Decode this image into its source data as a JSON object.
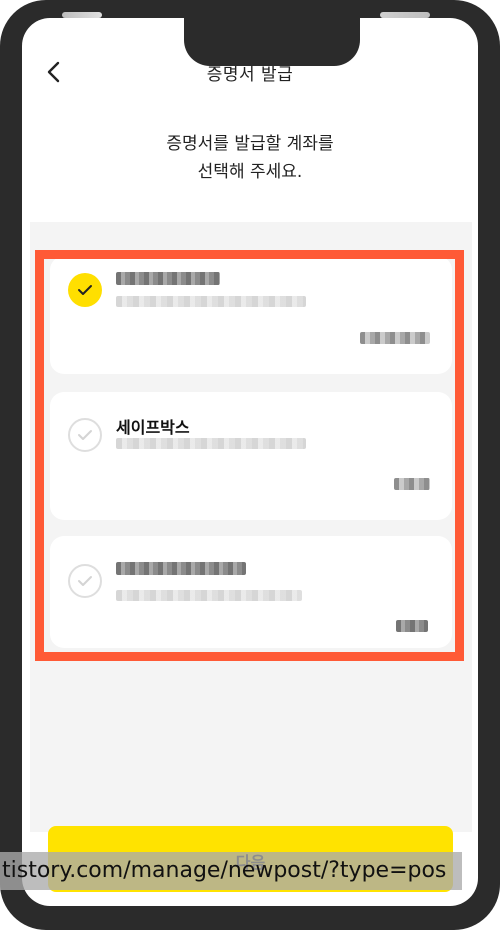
{
  "header": {
    "title": "증명서 발급"
  },
  "instruction": {
    "line1": "증명서를 발급할 계좌를",
    "line2": "선택해 주세요."
  },
  "accounts": [
    {
      "name": "",
      "selected": true
    },
    {
      "name": "세이프박스",
      "selected": false
    },
    {
      "name": "",
      "selected": false
    }
  ],
  "footer": {
    "next_label": "다음"
  },
  "overlay": {
    "url_text": "tistory.com/manage/newpost/?type=pos"
  },
  "colors": {
    "accent_yellow": "#ffe300",
    "highlight_border": "#ff5a36",
    "frame": "#2b2b2b",
    "list_background": "#f4f4f4"
  }
}
